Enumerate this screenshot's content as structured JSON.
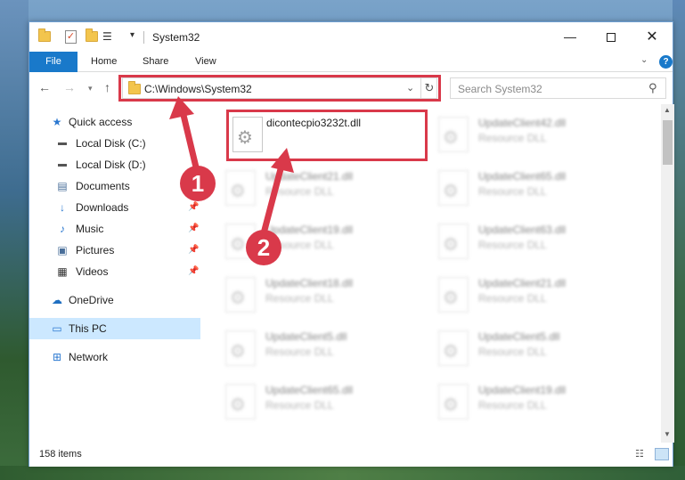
{
  "window": {
    "title": "System32",
    "controls": {
      "minimize": "—",
      "maximize": "",
      "close": "✕"
    }
  },
  "ribbon": {
    "tabs": [
      {
        "label": "File"
      },
      {
        "label": "Home"
      },
      {
        "label": "Share"
      },
      {
        "label": "View"
      }
    ],
    "help": "?"
  },
  "address": {
    "path": "C:\\Windows\\System32",
    "search_placeholder": "Search System32"
  },
  "navigation": {
    "items": [
      {
        "label": "Quick access",
        "icon": "star-icon",
        "pinned": false
      },
      {
        "label": "Local Disk (C:)",
        "icon": "drive-icon",
        "pinned": true
      },
      {
        "label": "Local Disk (D:)",
        "icon": "drive-icon",
        "pinned": true
      },
      {
        "label": "Documents",
        "icon": "document-icon",
        "pinned": true
      },
      {
        "label": "Downloads",
        "icon": "download-icon",
        "pinned": true
      },
      {
        "label": "Music",
        "icon": "music-icon",
        "pinned": true
      },
      {
        "label": "Pictures",
        "icon": "picture-icon",
        "pinned": true
      },
      {
        "label": "Videos",
        "icon": "video-icon",
        "pinned": true
      },
      {
        "label": "OneDrive",
        "icon": "cloud-icon",
        "pinned": false
      },
      {
        "label": "This PC",
        "icon": "computer-icon",
        "pinned": false,
        "selected": true
      },
      {
        "label": "Network",
        "icon": "network-icon",
        "pinned": false
      }
    ]
  },
  "files": {
    "highlighted": {
      "name": "dicontecpio3232t.dll"
    },
    "left_column": [
      {
        "name": "UpdateClient21.dll",
        "type": "Resource DLL"
      },
      {
        "name": "UpdateClient19.dll",
        "type": "Resource DLL"
      },
      {
        "name": "UpdateClient18.dll",
        "type": "Resource DLL"
      },
      {
        "name": "UpdateClient5.dll",
        "type": "Resource DLL"
      },
      {
        "name": "UpdateClient65.dll",
        "type": "Resource DLL"
      }
    ],
    "right_column": [
      {
        "name": "UpdateClient42.dll",
        "type": "Resource DLL"
      },
      {
        "name": "UpdateClient65.dll",
        "type": "Resource DLL"
      },
      {
        "name": "UpdateClient63.dll",
        "type": "Resource DLL"
      },
      {
        "name": "UpdateClient21.dll",
        "type": "Resource DLL"
      },
      {
        "name": "UpdateClient5.dll",
        "type": "Resource DLL"
      },
      {
        "name": "UpdateClient19.dll",
        "type": "Resource DLL"
      }
    ]
  },
  "status": {
    "item_count": "158 items"
  },
  "annotations": {
    "step1": "1",
    "step2": "2",
    "color": "#d9394a"
  }
}
